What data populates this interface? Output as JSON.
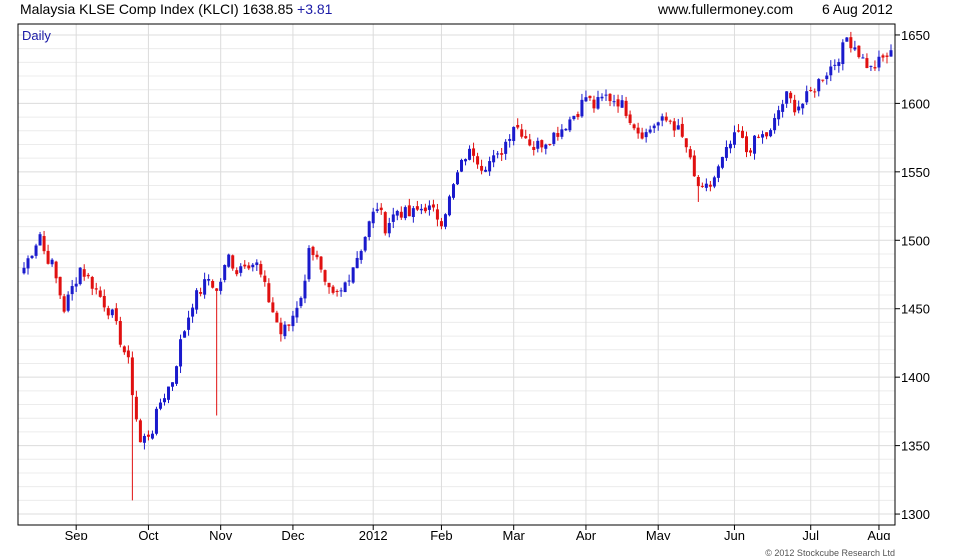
{
  "header": {
    "title": "Malaysia KLSE Comp Index (KLCI)",
    "last": "1638.85",
    "change": "+3.81",
    "site": "www.fullermoney.com",
    "date": "6 Aug 2012"
  },
  "footer": {
    "copyright": "© 2012 Stockcube Research Ltd"
  },
  "colors": {
    "up": "#1a1acc",
    "down": "#e01010",
    "grid": "#dcdcdc",
    "frame": "#000000"
  },
  "chart_data": {
    "type": "candlestick",
    "period_label": "Daily",
    "y_axis_side": "right",
    "ylim": [
      1292,
      1658
    ],
    "yticks": [
      1300,
      1350,
      1400,
      1450,
      1500,
      1550,
      1600,
      1650
    ],
    "x_ticks": [
      {
        "label": "Sep",
        "index": 13
      },
      {
        "label": "Oct",
        "index": 31
      },
      {
        "label": "Nov",
        "index": 49
      },
      {
        "label": "Dec",
        "index": 67
      },
      {
        "label": "2012",
        "index": 87
      },
      {
        "label": "Feb",
        "index": 104
      },
      {
        "label": "Mar",
        "index": 122
      },
      {
        "label": "Apr",
        "index": 140
      },
      {
        "label": "May",
        "index": 158
      },
      {
        "label": "Jun",
        "index": 177
      },
      {
        "label": "Jul",
        "index": 196
      },
      {
        "label": "Aug",
        "index": 213
      }
    ],
    "n_bars": 217,
    "anchors": [
      [
        0,
        1480
      ],
      [
        4,
        1505
      ],
      [
        5,
        1492
      ],
      [
        7,
        1482
      ],
      [
        10,
        1450
      ],
      [
        14,
        1480
      ],
      [
        17,
        1468
      ],
      [
        22,
        1445
      ],
      [
        26,
        1410
      ],
      [
        28,
        1370
      ],
      [
        29,
        1352
      ],
      [
        32,
        1362
      ],
      [
        34,
        1382
      ],
      [
        37,
        1398
      ],
      [
        39,
        1425
      ],
      [
        42,
        1455
      ],
      [
        46,
        1472
      ],
      [
        47,
        1468
      ],
      [
        48,
        1462
      ],
      [
        51,
        1488
      ],
      [
        53,
        1478
      ],
      [
        55,
        1485
      ],
      [
        58,
        1482
      ],
      [
        62,
        1448
      ],
      [
        64,
        1432
      ],
      [
        66,
        1438
      ],
      [
        70,
        1468
      ],
      [
        71,
        1498
      ],
      [
        73,
        1485
      ],
      [
        75,
        1465
      ],
      [
        77,
        1458
      ],
      [
        79,
        1462
      ],
      [
        82,
        1482
      ],
      [
        84,
        1495
      ],
      [
        86,
        1512
      ],
      [
        88,
        1525
      ],
      [
        90,
        1510
      ],
      [
        93,
        1522
      ],
      [
        96,
        1518
      ],
      [
        100,
        1525
      ],
      [
        104,
        1515
      ],
      [
        106,
        1530
      ],
      [
        108,
        1548
      ],
      [
        110,
        1562
      ],
      [
        112,
        1565
      ],
      [
        114,
        1555
      ],
      [
        118,
        1560
      ],
      [
        120,
        1572
      ],
      [
        122,
        1585
      ],
      [
        124,
        1580
      ],
      [
        127,
        1568
      ],
      [
        131,
        1575
      ],
      [
        134,
        1582
      ],
      [
        138,
        1595
      ],
      [
        140,
        1605
      ],
      [
        142,
        1598
      ],
      [
        145,
        1605
      ],
      [
        148,
        1602
      ],
      [
        150,
        1595
      ],
      [
        153,
        1580
      ],
      [
        155,
        1578
      ],
      [
        157,
        1585
      ],
      [
        161,
        1588
      ],
      [
        163,
        1580
      ],
      [
        165,
        1568
      ],
      [
        167,
        1545
      ],
      [
        169,
        1535
      ],
      [
        171,
        1540
      ],
      [
        174,
        1558
      ],
      [
        176,
        1570
      ],
      [
        178,
        1578
      ],
      [
        180,
        1565
      ],
      [
        183,
        1575
      ],
      [
        186,
        1578
      ],
      [
        188,
        1595
      ],
      [
        190,
        1605
      ],
      [
        192,
        1598
      ],
      [
        194,
        1600
      ],
      [
        197,
        1612
      ],
      [
        199,
        1620
      ],
      [
        202,
        1630
      ],
      [
        204,
        1640
      ],
      [
        205,
        1648
      ],
      [
        207,
        1642
      ],
      [
        209,
        1632
      ],
      [
        211,
        1625
      ],
      [
        213,
        1630
      ],
      [
        215,
        1635
      ],
      [
        216,
        1638.85
      ]
    ],
    "spikes": [
      {
        "index": 27,
        "low": 1310
      },
      {
        "index": 48,
        "low": 1372
      },
      {
        "index": 64,
        "low": 1426
      },
      {
        "index": 168,
        "low": 1528
      }
    ],
    "last_close": 1638.85
  }
}
